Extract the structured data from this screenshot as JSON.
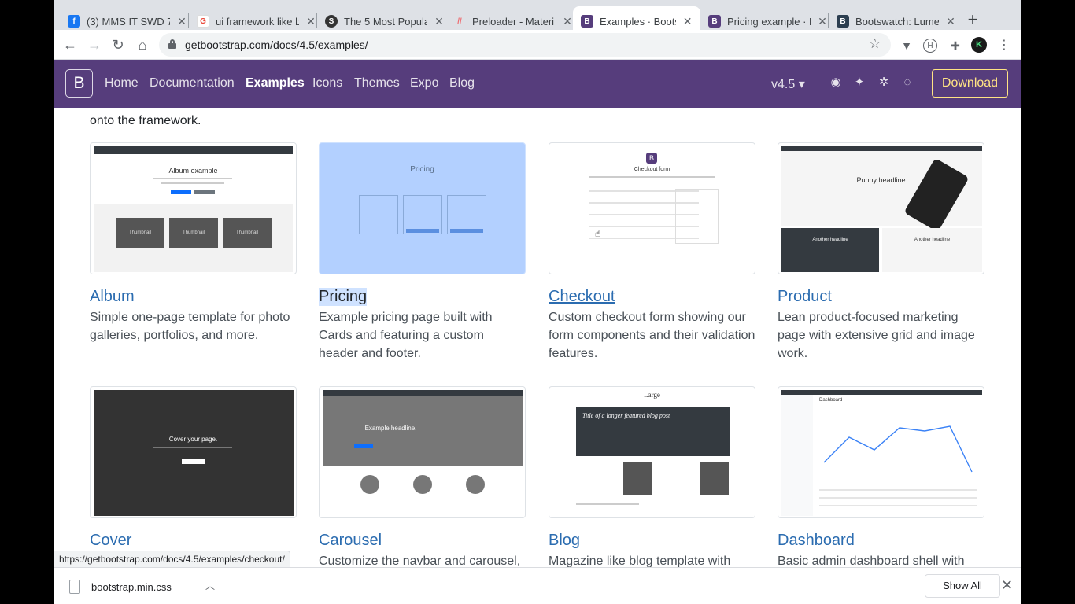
{
  "browser": {
    "tabs": [
      {
        "label": "(3) MMS IT SWD 7",
        "favicon": "F",
        "favcolor": "#1877f2"
      },
      {
        "label": "ui framework like b",
        "favicon": "G",
        "favcolor": "#ea4335"
      },
      {
        "label": "The 5 Most Popula",
        "favicon": "S",
        "favcolor": "#333333"
      },
      {
        "label": "Preloader - Materi",
        "favicon": "M",
        "favcolor": "#ee6e73"
      },
      {
        "label": "Examples · Bootstr",
        "favicon": "B",
        "favcolor": "#563d7c"
      },
      {
        "label": "Pricing example · B",
        "favicon": "B",
        "favcolor": "#563d7c"
      },
      {
        "label": "Bootswatch: Lume",
        "favicon": "B",
        "favcolor": "#2c3e50"
      }
    ],
    "new_tab": "+",
    "url": "getbootstrap.com/docs/4.5/examples/",
    "status_url": "https://getbootstrap.com/docs/4.5/examples/checkout/"
  },
  "navbar": {
    "brand": "B",
    "links": [
      "Home",
      "Documentation",
      "Examples",
      "Icons",
      "Themes",
      "Expo",
      "Blog"
    ],
    "version": "v4.5 ▾",
    "download": "Download"
  },
  "content": {
    "intro": "onto the framework.",
    "cards": [
      {
        "title": "Album",
        "desc": "Simple one-page template for photo galleries, portfolios, and more.",
        "thumb_title": "Album example"
      },
      {
        "title": "Pricing",
        "desc": "Example pricing page built with Cards and featuring a custom header and footer.",
        "thumb_title": "Pricing"
      },
      {
        "title": "Checkout",
        "desc": "Custom checkout form showing our form components and their validation features.",
        "thumb_title": "Checkout form"
      },
      {
        "title": "Product",
        "desc": "Lean product-focused marketing page with extensive grid and image work.",
        "thumb_title": "Punny headline"
      },
      {
        "title": "Cover",
        "desc": "",
        "thumb_title": "Cover your page."
      },
      {
        "title": "Carousel",
        "desc": "Customize the navbar and carousel,",
        "thumb_title": "Example headline."
      },
      {
        "title": "Blog",
        "desc": "Magazine like blog template with",
        "thumb_title": "Title of a longer featured blog post"
      },
      {
        "title": "Dashboard",
        "desc": "Basic admin dashboard shell with",
        "thumb_title": "Dashboard"
      }
    ]
  },
  "downloads": {
    "file": "bootstrap.min.css",
    "show_all": "Show All"
  }
}
